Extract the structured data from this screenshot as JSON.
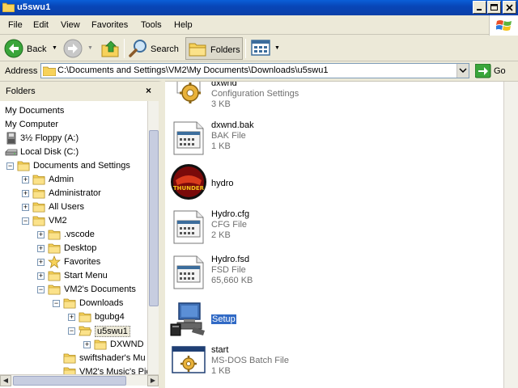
{
  "window": {
    "title": "u5swu1"
  },
  "menu": [
    "File",
    "Edit",
    "View",
    "Favorites",
    "Tools",
    "Help"
  ],
  "toolbar": {
    "back": "Back",
    "search": "Search",
    "folders": "Folders"
  },
  "address": {
    "label": "Address",
    "path": "C:\\Documents and Settings\\VM2\\My Documents\\Downloads\\u5swu1",
    "go": "Go"
  },
  "folders_pane": {
    "title": "Folders",
    "close": "×",
    "tree": [
      {
        "label": "My Documents",
        "icon": "none",
        "indent": 0,
        "expander": ""
      },
      {
        "label": "My Computer",
        "icon": "none",
        "indent": 0,
        "expander": ""
      },
      {
        "label": "3½ Floppy (A:)",
        "icon": "floppy-icon",
        "indent": 0,
        "expander": ""
      },
      {
        "label": "Local Disk (C:)",
        "icon": "drive-icon",
        "indent": 0,
        "expander": ""
      },
      {
        "label": "Documents and Settings",
        "icon": "folder-icon",
        "indent": 1,
        "expander": "−"
      },
      {
        "label": "Admin",
        "icon": "folder-icon",
        "indent": 2,
        "expander": "+"
      },
      {
        "label": "Administrator",
        "icon": "folder-icon",
        "indent": 2,
        "expander": "+"
      },
      {
        "label": "All Users",
        "icon": "folder-icon",
        "indent": 2,
        "expander": "+"
      },
      {
        "label": "VM2",
        "icon": "folder-icon",
        "indent": 2,
        "expander": "−"
      },
      {
        "label": ".vscode",
        "icon": "folder-icon",
        "indent": 3,
        "expander": "+"
      },
      {
        "label": "Desktop",
        "icon": "folder-icon",
        "indent": 3,
        "expander": "+"
      },
      {
        "label": "Favorites",
        "icon": "star-icon",
        "indent": 3,
        "expander": "+"
      },
      {
        "label": "Start Menu",
        "icon": "folder-icon",
        "indent": 3,
        "expander": "+"
      },
      {
        "label": "VM2's Documents",
        "icon": "folder-icon",
        "indent": 3,
        "expander": "−"
      },
      {
        "label": "Downloads",
        "icon": "folder-icon",
        "indent": 4,
        "expander": "−"
      },
      {
        "label": "bgubg4",
        "icon": "folder-icon",
        "indent": 5,
        "expander": "+"
      },
      {
        "label": "u5swu1",
        "icon": "folder-open-icon",
        "indent": 5,
        "expander": "−",
        "selected": true
      },
      {
        "label": "DXWND",
        "icon": "folder-icon",
        "indent": 6,
        "expander": "+"
      },
      {
        "label": "swiftshader's Mu",
        "icon": "folder-icon",
        "indent": 4,
        "expander": ""
      },
      {
        "label": "VM2's Music's Pic",
        "icon": "folder-icon",
        "indent": 4,
        "expander": ""
      }
    ]
  },
  "files": [
    {
      "name": "dxwnd",
      "type": "Configuration Settings",
      "size": "3 KB",
      "icon": "config-settings-icon"
    },
    {
      "name": "dxwnd.bak",
      "type": "BAK File",
      "size": "1 KB",
      "icon": "generic-file-icon"
    },
    {
      "name": "hydro",
      "type": "",
      "size": "",
      "icon": "hydro-thunder-app-icon"
    },
    {
      "name": "Hydro.cfg",
      "type": "CFG File",
      "size": "2 KB",
      "icon": "generic-file-icon"
    },
    {
      "name": "Hydro.fsd",
      "type": "FSD File",
      "size": "65,660 KB",
      "icon": "generic-file-icon"
    },
    {
      "name": "Setup",
      "type": "",
      "size": "",
      "icon": "setup-computer-icon",
      "selected": true
    },
    {
      "name": "start",
      "type": "MS-DOS Batch File",
      "size": "1 KB",
      "icon": "batch-file-icon"
    }
  ]
}
